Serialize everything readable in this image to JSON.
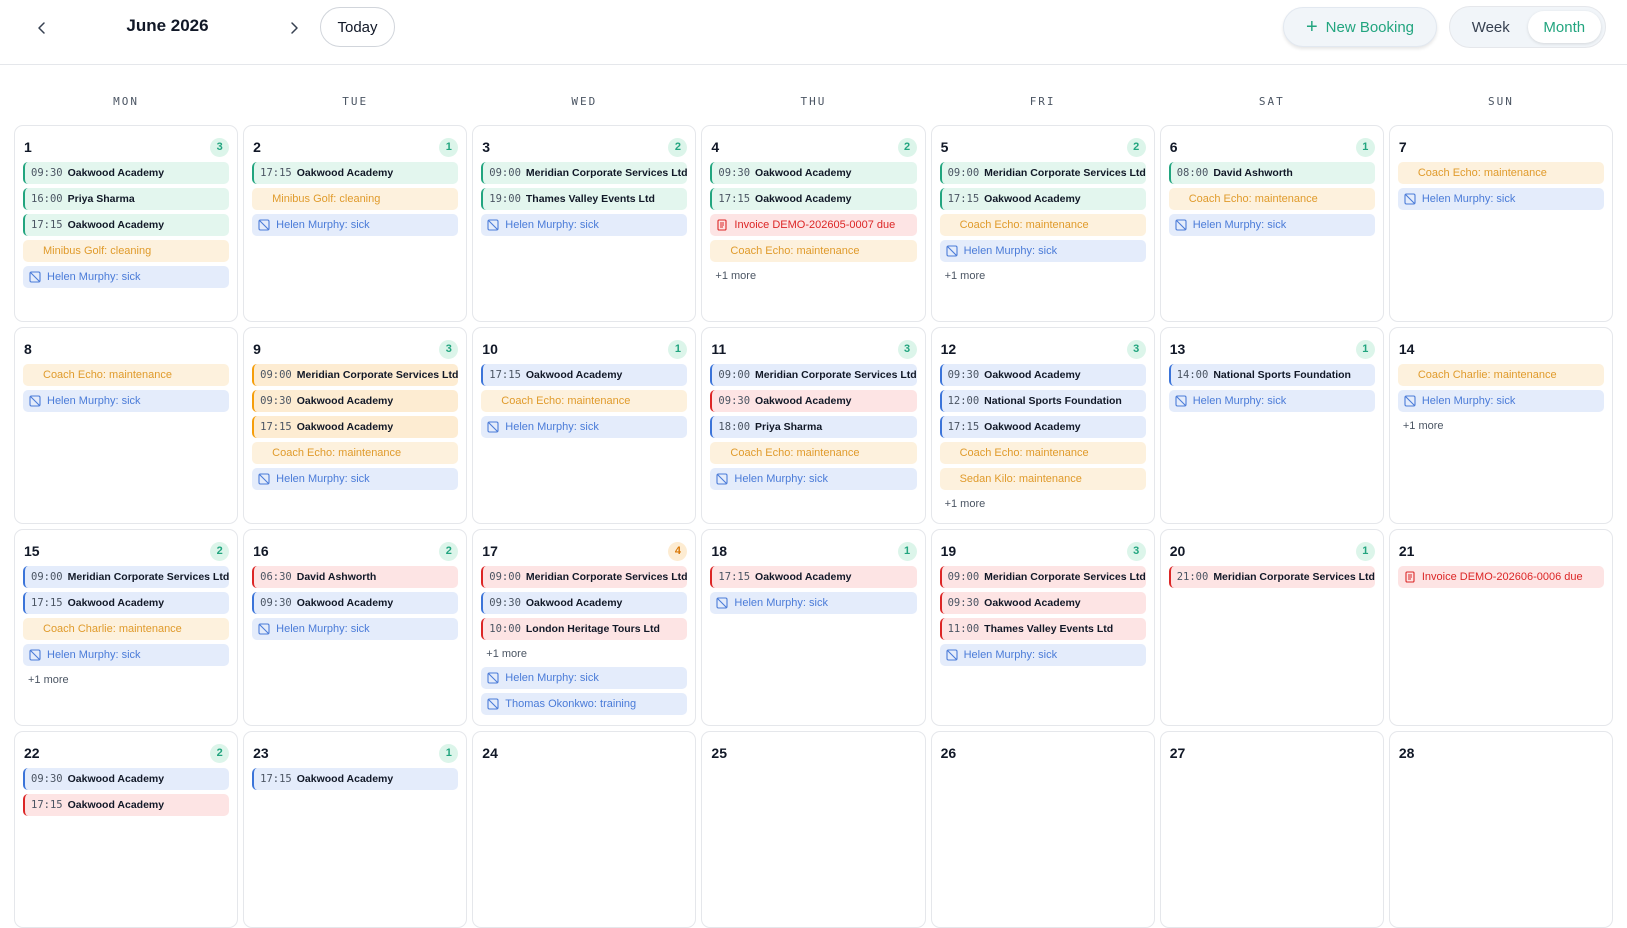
{
  "header": {
    "month_title": "June 2026",
    "today_label": "Today",
    "new_booking_label": "New Booking",
    "views": [
      "Week",
      "Month"
    ],
    "active_view": "Month"
  },
  "colors": {
    "accent": "#22a57f",
    "booking_green": "#22a57f",
    "booking_blue": "#3b74d9",
    "booking_red": "#dc2626",
    "booking_orange": "#f59e0b",
    "maintenance": "#e09b2c",
    "sick": "#4a7bd8",
    "invoice": "#dc2626"
  },
  "weekdays": [
    "MON",
    "TUE",
    "WED",
    "THU",
    "FRI",
    "SAT",
    "SUN"
  ],
  "days": [
    {
      "num": "1",
      "count": "3",
      "events": [
        {
          "kind": "booking",
          "color": "green",
          "time": "09:30",
          "name": "Oakwood Academy"
        },
        {
          "kind": "booking",
          "color": "green",
          "time": "16:00",
          "name": "Priya Sharma"
        },
        {
          "kind": "booking",
          "color": "green",
          "time": "17:15",
          "name": "Oakwood Academy"
        },
        {
          "kind": "maint",
          "text": "Minibus Golf: cleaning"
        },
        {
          "kind": "sick",
          "text": "Helen Murphy: sick"
        }
      ]
    },
    {
      "num": "2",
      "count": "1",
      "events": [
        {
          "kind": "booking",
          "color": "green",
          "time": "17:15",
          "name": "Oakwood Academy"
        },
        {
          "kind": "maint",
          "text": "Minibus Golf: cleaning"
        },
        {
          "kind": "sick",
          "text": "Helen Murphy: sick"
        }
      ]
    },
    {
      "num": "3",
      "count": "2",
      "events": [
        {
          "kind": "booking",
          "color": "green",
          "time": "09:00",
          "name": "Meridian Corporate Services Ltd"
        },
        {
          "kind": "booking",
          "color": "green",
          "time": "19:00",
          "name": "Thames Valley Events Ltd"
        },
        {
          "kind": "sick",
          "text": "Helen Murphy: sick"
        }
      ]
    },
    {
      "num": "4",
      "count": "2",
      "events": [
        {
          "kind": "booking",
          "color": "green",
          "time": "09:30",
          "name": "Oakwood Academy"
        },
        {
          "kind": "booking",
          "color": "green",
          "time": "17:15",
          "name": "Oakwood Academy"
        },
        {
          "kind": "invoice",
          "text": "Invoice DEMO-202605-0007 due"
        },
        {
          "kind": "maint",
          "text": "Coach Echo: maintenance"
        }
      ],
      "more": "+1 more"
    },
    {
      "num": "5",
      "count": "2",
      "events": [
        {
          "kind": "booking",
          "color": "green",
          "time": "09:00",
          "name": "Meridian Corporate Services Ltd"
        },
        {
          "kind": "booking",
          "color": "green",
          "time": "17:15",
          "name": "Oakwood Academy"
        },
        {
          "kind": "maint",
          "text": "Coach Echo: maintenance"
        },
        {
          "kind": "sick",
          "text": "Helen Murphy: sick"
        }
      ],
      "more": "+1 more"
    },
    {
      "num": "6",
      "count": "1",
      "events": [
        {
          "kind": "booking",
          "color": "green",
          "time": "08:00",
          "name": "David Ashworth"
        },
        {
          "kind": "maint",
          "text": "Coach Echo: maintenance"
        },
        {
          "kind": "sick",
          "text": "Helen Murphy: sick"
        }
      ]
    },
    {
      "num": "7",
      "count": "",
      "events": [
        {
          "kind": "maint",
          "text": "Coach Echo: maintenance"
        },
        {
          "kind": "sick",
          "text": "Helen Murphy: sick"
        }
      ]
    },
    {
      "num": "8",
      "count": "",
      "events": [
        {
          "kind": "maint",
          "text": "Coach Echo: maintenance"
        },
        {
          "kind": "sick",
          "text": "Helen Murphy: sick"
        }
      ]
    },
    {
      "num": "9",
      "count": "3",
      "events": [
        {
          "kind": "booking",
          "color": "orange",
          "time": "09:00",
          "name": "Meridian Corporate Services Ltd"
        },
        {
          "kind": "booking",
          "color": "orange",
          "time": "09:30",
          "name": "Oakwood Academy"
        },
        {
          "kind": "booking",
          "color": "orange",
          "time": "17:15",
          "name": "Oakwood Academy"
        },
        {
          "kind": "maint",
          "text": "Coach Echo: maintenance"
        },
        {
          "kind": "sick",
          "text": "Helen Murphy: sick"
        }
      ]
    },
    {
      "num": "10",
      "count": "1",
      "events": [
        {
          "kind": "booking",
          "color": "blue",
          "time": "17:15",
          "name": "Oakwood Academy"
        },
        {
          "kind": "maint",
          "text": "Coach Echo: maintenance"
        },
        {
          "kind": "sick",
          "text": "Helen Murphy: sick"
        }
      ]
    },
    {
      "num": "11",
      "count": "3",
      "events": [
        {
          "kind": "booking",
          "color": "blue",
          "time": "09:00",
          "name": "Meridian Corporate Services Ltd"
        },
        {
          "kind": "booking",
          "color": "red",
          "time": "09:30",
          "name": "Oakwood Academy"
        },
        {
          "kind": "booking",
          "color": "blue",
          "time": "18:00",
          "name": "Priya Sharma"
        },
        {
          "kind": "maint",
          "text": "Coach Echo: maintenance"
        },
        {
          "kind": "sick",
          "text": "Helen Murphy: sick"
        }
      ]
    },
    {
      "num": "12",
      "count": "3",
      "events": [
        {
          "kind": "booking",
          "color": "blue",
          "time": "09:30",
          "name": "Oakwood Academy"
        },
        {
          "kind": "booking",
          "color": "blue",
          "time": "12:00",
          "name": "National Sports Foundation"
        },
        {
          "kind": "booking",
          "color": "blue",
          "time": "17:15",
          "name": "Oakwood Academy"
        },
        {
          "kind": "maint",
          "text": "Coach Echo: maintenance"
        },
        {
          "kind": "maint",
          "text": "Sedan Kilo: maintenance"
        }
      ],
      "more": "+1 more"
    },
    {
      "num": "13",
      "count": "1",
      "events": [
        {
          "kind": "booking",
          "color": "blue",
          "time": "14:00",
          "name": "National Sports Foundation"
        },
        {
          "kind": "sick",
          "text": "Helen Murphy: sick"
        }
      ]
    },
    {
      "num": "14",
      "count": "",
      "events": [
        {
          "kind": "maint",
          "text": "Coach Charlie: maintenance"
        },
        {
          "kind": "sick",
          "text": "Helen Murphy: sick"
        }
      ],
      "more": "+1 more"
    },
    {
      "num": "15",
      "count": "2",
      "events": [
        {
          "kind": "booking",
          "color": "blue",
          "time": "09:00",
          "name": "Meridian Corporate Services Ltd"
        },
        {
          "kind": "booking",
          "color": "blue",
          "time": "17:15",
          "name": "Oakwood Academy"
        },
        {
          "kind": "maint",
          "text": "Coach Charlie: maintenance"
        },
        {
          "kind": "sick",
          "text": "Helen Murphy: sick"
        }
      ],
      "more": "+1 more"
    },
    {
      "num": "16",
      "count": "2",
      "events": [
        {
          "kind": "booking",
          "color": "red",
          "time": "06:30",
          "name": "David Ashworth"
        },
        {
          "kind": "booking",
          "color": "blue",
          "time": "09:30",
          "name": "Oakwood Academy"
        },
        {
          "kind": "sick",
          "text": "Helen Murphy: sick"
        }
      ]
    },
    {
      "num": "17",
      "count": "4",
      "count_warn": true,
      "events": [
        {
          "kind": "booking",
          "color": "red",
          "time": "09:00",
          "name": "Meridian Corporate Services Ltd"
        },
        {
          "kind": "booking",
          "color": "blue",
          "time": "09:30",
          "name": "Oakwood Academy"
        },
        {
          "kind": "booking",
          "color": "red",
          "time": "10:00",
          "name": "London Heritage Tours Ltd"
        },
        {
          "kind": "more",
          "text": "+1 more"
        },
        {
          "kind": "sick",
          "text": "Helen Murphy: sick"
        },
        {
          "kind": "sick",
          "text": "Thomas Okonkwo: training"
        }
      ]
    },
    {
      "num": "18",
      "count": "1",
      "events": [
        {
          "kind": "booking",
          "color": "red",
          "time": "17:15",
          "name": "Oakwood Academy"
        },
        {
          "kind": "sick",
          "text": "Helen Murphy: sick"
        }
      ]
    },
    {
      "num": "19",
      "count": "3",
      "events": [
        {
          "kind": "booking",
          "color": "red",
          "time": "09:00",
          "name": "Meridian Corporate Services Ltd"
        },
        {
          "kind": "booking",
          "color": "red",
          "time": "09:30",
          "name": "Oakwood Academy"
        },
        {
          "kind": "booking",
          "color": "red",
          "time": "11:00",
          "name": "Thames Valley Events Ltd"
        },
        {
          "kind": "sick",
          "text": "Helen Murphy: sick"
        }
      ]
    },
    {
      "num": "20",
      "count": "1",
      "events": [
        {
          "kind": "booking",
          "color": "red",
          "time": "21:00",
          "name": "Meridian Corporate Services Ltd"
        }
      ]
    },
    {
      "num": "21",
      "count": "",
      "events": [
        {
          "kind": "invoice",
          "text": "Invoice DEMO-202606-0006 due"
        }
      ]
    },
    {
      "num": "22",
      "count": "2",
      "events": [
        {
          "kind": "booking",
          "color": "blue",
          "time": "09:30",
          "name": "Oakwood Academy"
        },
        {
          "kind": "booking",
          "color": "red",
          "time": "17:15",
          "name": "Oakwood Academy"
        }
      ]
    },
    {
      "num": "23",
      "count": "1",
      "events": [
        {
          "kind": "booking",
          "color": "blue",
          "time": "17:15",
          "name": "Oakwood Academy"
        }
      ]
    },
    {
      "num": "24",
      "count": "",
      "events": []
    },
    {
      "num": "25",
      "count": "",
      "events": []
    },
    {
      "num": "26",
      "count": "",
      "events": []
    },
    {
      "num": "27",
      "count": "",
      "events": []
    },
    {
      "num": "28",
      "count": "",
      "events": []
    }
  ]
}
